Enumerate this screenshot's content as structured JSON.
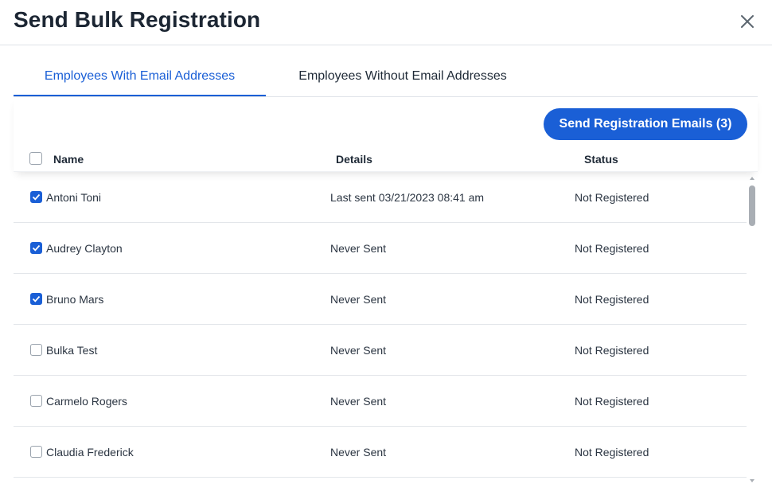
{
  "dialog": {
    "title": "Send Bulk Registration",
    "close_icon": "close-icon"
  },
  "tabs": [
    {
      "label": "Employees With Email Addresses",
      "active": true
    },
    {
      "label": "Employees Without Email Addresses",
      "active": false
    }
  ],
  "toolbar": {
    "send_label": "Send Registration Emails (3)"
  },
  "table": {
    "columns": [
      "Name",
      "Details",
      "Status"
    ],
    "select_all_checked": false,
    "rows": [
      {
        "name": "Antoni Toni",
        "details": "Last sent 03/21/2023 08:41 am",
        "status": "Not Registered",
        "checked": true
      },
      {
        "name": "Audrey Clayton",
        "details": "Never Sent",
        "status": "Not Registered",
        "checked": true
      },
      {
        "name": "Bruno Mars",
        "details": "Never Sent",
        "status": "Not Registered",
        "checked": true
      },
      {
        "name": "Bulka Test",
        "details": "Never Sent",
        "status": "Not Registered",
        "checked": false
      },
      {
        "name": "Carmelo Rogers",
        "details": "Never Sent",
        "status": "Not Registered",
        "checked": false
      },
      {
        "name": "Claudia Frederick",
        "details": "Never Sent",
        "status": "Not Registered",
        "checked": false
      }
    ]
  },
  "colors": {
    "accent": "#1a5fd6",
    "text": "#1f2a37",
    "border": "#dfe3e8"
  }
}
